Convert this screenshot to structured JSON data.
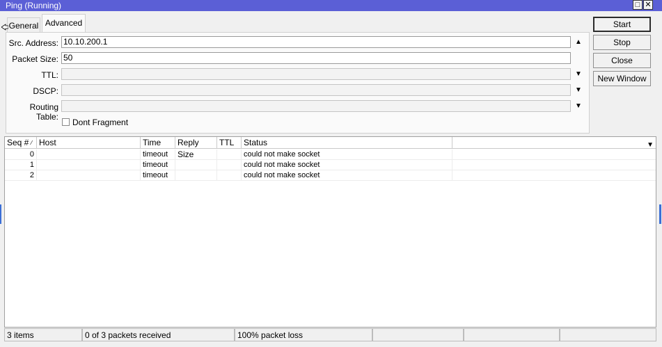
{
  "window": {
    "title": "Ping (Running)"
  },
  "tabs": [
    {
      "label": "General"
    },
    {
      "label": "Advanced"
    }
  ],
  "form": {
    "src_address": {
      "label": "Src. Address:",
      "value": "10.10.200.1"
    },
    "packet_size": {
      "label": "Packet Size:",
      "value": "50"
    },
    "ttl": {
      "label": "TTL:",
      "value": ""
    },
    "dscp": {
      "label": "DSCP:",
      "value": ""
    },
    "routing_table": {
      "label": "Routing Table:",
      "value": ""
    },
    "dont_fragment": {
      "label": "Dont Fragment",
      "checked": false
    }
  },
  "buttons": {
    "start": "Start",
    "stop": "Stop",
    "close": "Close",
    "new_window": "New Window"
  },
  "table": {
    "columns": [
      "Seq #",
      "Host",
      "Time",
      "Reply Size",
      "TTL",
      "Status"
    ],
    "rows": [
      {
        "seq": "0",
        "host": "",
        "time": "timeout",
        "reply_size": "",
        "ttl": "",
        "status": "could not make socket"
      },
      {
        "seq": "1",
        "host": "",
        "time": "timeout",
        "reply_size": "",
        "ttl": "",
        "status": "could not make socket"
      },
      {
        "seq": "2",
        "host": "",
        "time": "timeout",
        "reply_size": "",
        "ttl": "",
        "status": "could not make socket"
      }
    ]
  },
  "statusbar": {
    "items": "3 items",
    "received": "0 of 3 packets received",
    "loss": "100% packet loss"
  },
  "colors": {
    "titlebar": "#5b5fd6"
  }
}
